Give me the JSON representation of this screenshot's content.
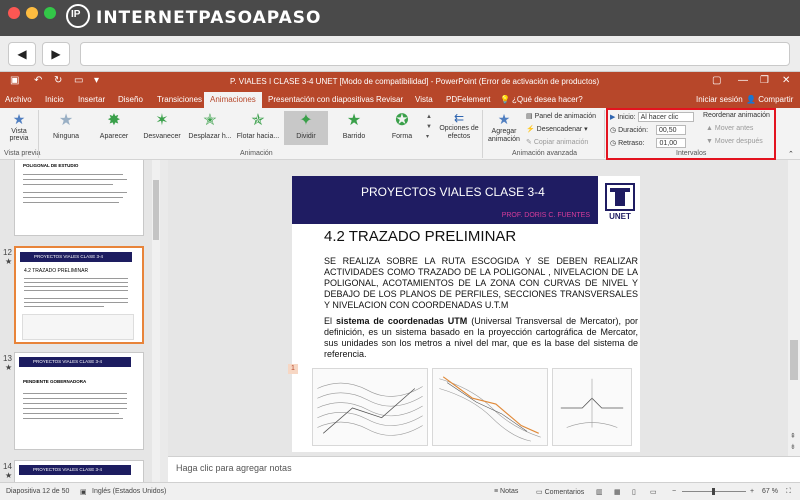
{
  "site": {
    "name": "INTERNETPASOAPASO",
    "logo_mark": "IP"
  },
  "window": {
    "title": "P. VIALES I  CLASE 3-4 UNET [Modo de compatibilidad] - PowerPoint (Error de activación de productos)"
  },
  "tabs": [
    "Archivo",
    "Inicio",
    "Insertar",
    "Diseño",
    "Transiciones",
    "Animaciones",
    "Presentación con diapositivas",
    "Revisar",
    "Vista",
    "PDFelement"
  ],
  "active_tab": "Animaciones",
  "tell_me": "¿Qué desea hacer?",
  "account": {
    "signin": "Iniciar sesión",
    "share": "Compartir"
  },
  "ribbon": {
    "preview": {
      "label": "Vista previa",
      "group": "Vista previa"
    },
    "animations": [
      "Ninguna",
      "Aparecer",
      "Desvanecer",
      "Desplazar h...",
      "Flotar hacia...",
      "Dividir",
      "Barrido",
      "Forma"
    ],
    "selected_animation": "Dividir",
    "effect_options": "Opciones de efectos",
    "group_animation": "Animación",
    "add_animation": "Agregar animación",
    "animation_pane": "Panel de animación",
    "trigger": "Desencadenar",
    "copy_animation": "Copiar animación",
    "group_advanced": "Animación avanzada",
    "timing": {
      "start_label": "Inicio:",
      "start_value": "Al hacer clic",
      "duration_label": "Duración:",
      "duration_value": "00,50",
      "delay_label": "Retraso:",
      "delay_value": "01,00",
      "reorder": "Reordenar animación",
      "move_earlier": "Mover antes",
      "move_later": "Mover después",
      "group": "Intervalos"
    }
  },
  "thumbnails": [
    {
      "number": "",
      "title": "POLIGONAL DE ESTUDIO"
    },
    {
      "number": "12",
      "title": "PROYECTOS VIALES  CLASE  3-4",
      "subtitle": "4.2 TRAZADO PRELIMINAR"
    },
    {
      "number": "13",
      "title": "PROYECTOS VIALES  CLASE  3-4",
      "subtitle": "PENDIENTE GOBERNADORA"
    },
    {
      "number": "14",
      "title": "PROYECTOS VIALES  CLASE  3-4"
    }
  ],
  "slide": {
    "title": "PROYECTOS VIALES  CLASE  3-4",
    "author": "PROF. DORIS C. FUENTES",
    "logo": "UNET",
    "section": "4.2 TRAZADO PRELIMINAR",
    "para1": "SE REALIZA SOBRE LA RUTA ESCOGIDA Y SE DEBEN REALIZAR ACTIVIDADES COMO TRAZADO DE LA POLIGONAL , NIVELACION DE LA POLIGONAL, ACOTAMIENTOS DE LA ZONA CON CURVAS DE NIVEL Y DEBAJO DE LOS PLANOS DE PERFILES, SECCIONES TRANSVERSALES Y NIVELACION CON COORDENADAS U.T.M",
    "para2_prefix": "El ",
    "para2_bold": "sistema de coordenadas UTM",
    "para2_rest": " (Universal Transversal de Mercator), por definición, es un sistema basado en la proyección cartográfica de Mercator, sus unidades son los metros a nivel del mar, que es la base del sistema de referencia.",
    "marker": "1"
  },
  "notes_placeholder": "Haga clic para agregar notas",
  "status": {
    "slide_info": "Diapositiva 12 de 50",
    "language": "Inglés (Estados Unidos)",
    "notes": "Notas",
    "comments": "Comentarios",
    "zoom": "67 %"
  }
}
